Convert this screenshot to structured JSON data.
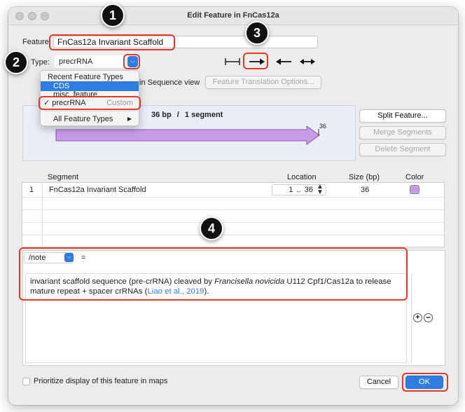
{
  "window": {
    "title": "Edit Feature in FnCas12a"
  },
  "feature": {
    "label": "Feature:",
    "name": "FnCas12a Invariant Scaffold"
  },
  "type": {
    "label": "Type:",
    "value": "precrRNA"
  },
  "view": {
    "suffix": "in Sequence view",
    "translation_button": "Feature Translation Options..."
  },
  "menu": {
    "header": "Recent Feature Types",
    "items": [
      {
        "label": "CDS",
        "selected": true
      },
      {
        "label": "misc_feature"
      }
    ],
    "checked_item": {
      "check": "✓",
      "label": "precrRNA",
      "badge": "Custom"
    },
    "all_types": "All Feature Types",
    "arrow": "▶"
  },
  "map": {
    "summary_bp": "36 bp",
    "summary_sep": "/",
    "summary_seg": "1 segment",
    "end_label": "36",
    "feature_color": "#c89be8"
  },
  "side_buttons": {
    "split": "Split Feature...",
    "merge": "Merge Segments",
    "delete": "Delete Segment"
  },
  "segments": {
    "headers": {
      "segment": "Segment",
      "location": "Location",
      "size": "Size (bp)",
      "color": "Color"
    },
    "rows": [
      {
        "index": "1",
        "name": "FnCas12a Invariant Scaffold",
        "start": "1",
        "sep": "..",
        "end": "36",
        "size": "36",
        "color": "#c89be8"
      }
    ]
  },
  "qualifier": {
    "key": "/note",
    "equals": "="
  },
  "note": {
    "line1_pre": "invariant scaffold sequence (pre-crRNA) cleaved by ",
    "line1_italic": "Francisella novicida",
    "line1_post": " U112 Cpf1/Cas12a to release",
    "line2_pre": "mature repeat + spacer crRNAs (",
    "line2_link": "Liao et al., 2019",
    "line2_post": ")."
  },
  "bottom": {
    "prioritize": "Prioritize display of this feature in maps",
    "cancel": "Cancel",
    "ok": "OK"
  },
  "callouts": [
    "1",
    "2",
    "3",
    "4"
  ],
  "colors": {
    "accent": "#2f7de1",
    "highlight": "#e0392b"
  }
}
